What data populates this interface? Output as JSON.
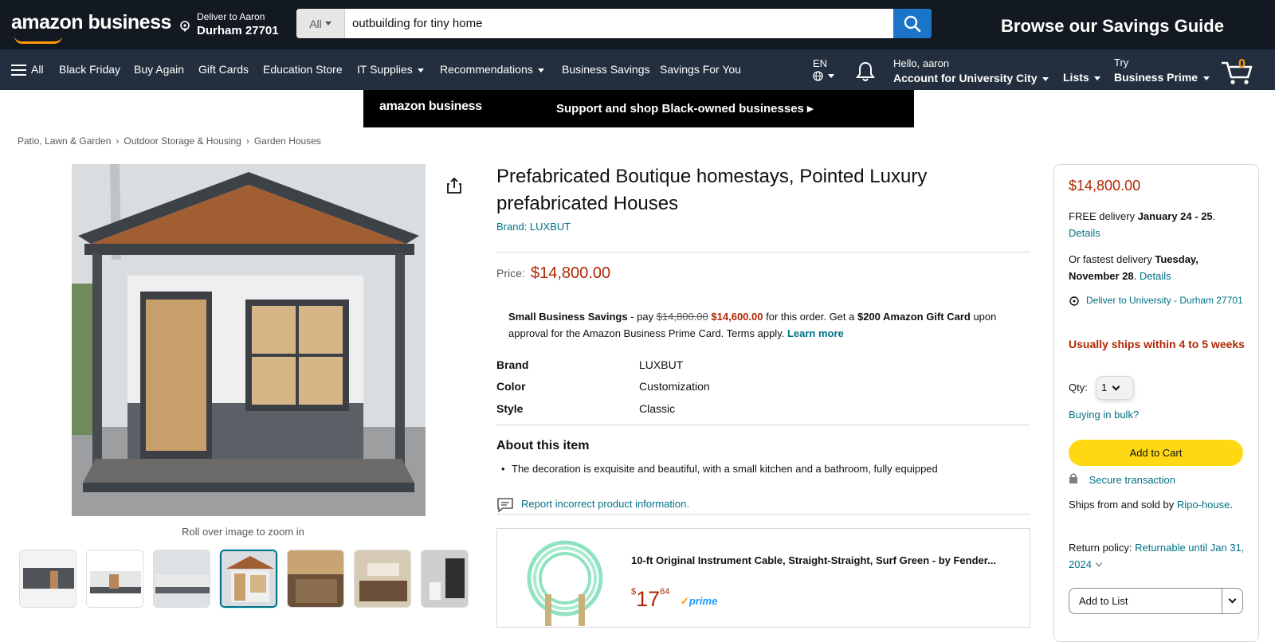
{
  "header": {
    "logo_text": "amazon business",
    "deliver_line1": "Deliver to Aaron",
    "deliver_line2": "Durham 27701",
    "search_category": "All",
    "search_value": "outbuilding for tiny home",
    "promo": "Browse our Savings Guide"
  },
  "nav": {
    "all": "All",
    "items": [
      "Black Friday",
      "Buy Again",
      "Gift Cards",
      "Education Store",
      "IT Supplies",
      "Recommendations",
      "Business Savings",
      "Savings For You"
    ],
    "lang": "EN",
    "hello": "Hello, aaron",
    "account": "Account for University City",
    "lists": "Lists",
    "try": "Try",
    "prime": "Business Prime",
    "cart_count": "0"
  },
  "banner": {
    "logo": "amazon business",
    "text": "Support and shop Black-owned businesses ▸"
  },
  "breadcrumb": [
    "Patio, Lawn & Garden",
    "Outdoor Storage & Housing",
    "Garden Houses"
  ],
  "gallery": {
    "zoom_hint": "Roll over image to zoom in",
    "selected_index": 3
  },
  "product": {
    "title": "Prefabricated Boutique homestays, Pointed Luxury prefabricated Houses",
    "brand_link": "Brand: LUXBUT",
    "price_label": "Price:",
    "price": "$14,800.00",
    "savings": {
      "label": "Small Business Savings",
      "pay": " - pay ",
      "old": "$14,800.00",
      "new": "$14,600.00",
      "mid": " for this order. Get a ",
      "gift": "$200 Amazon Gift Card",
      "rest": " upon approval for the Amazon Business Prime Card. Terms apply. ",
      "learn": "Learn more"
    },
    "specs": [
      {
        "k": "Brand",
        "v": "LUXBUT"
      },
      {
        "k": "Color",
        "v": "Customization"
      },
      {
        "k": "Style",
        "v": "Classic"
      }
    ],
    "about_title": "About this item",
    "bullets": [
      "The decoration is exquisite and beautiful, with a small kitchen and a bathroom, fully equipped"
    ],
    "report": "Report incorrect product information."
  },
  "ad": {
    "title": "10-ft Original Instrument Cable, Straight-Straight, Surf Green - by Fender...",
    "price_dollar": "$",
    "price_whole": "17",
    "price_cents": "64",
    "prime": "prime"
  },
  "buybox": {
    "price": "$14,800.00",
    "free_delivery": "FREE delivery ",
    "free_date": "January 24 - 25",
    "details": "Details",
    "fastest": "Or fastest delivery ",
    "fastest_date": "Tuesday, November 28",
    "deliver_to": "Deliver to University - Durham 27701",
    "ships": "Usually ships within 4 to 5 weeks",
    "qty_label": "Qty:",
    "qty_value": "1",
    "bulk": "Buying in bulk?",
    "add_to_cart": "Add to Cart",
    "secure": "Secure transaction",
    "ships_from": "Ships from and sold by ",
    "seller": "Ripo-house",
    "return_label": "Return policy: ",
    "return_value": "Returnable until Jan 31, 2024",
    "add_to_list": "Add to List"
  },
  "colors": {
    "nav": "#131921",
    "subnav": "#232f3e",
    "price": "#b12704",
    "link": "#007185",
    "cart_button": "#ffd814"
  }
}
